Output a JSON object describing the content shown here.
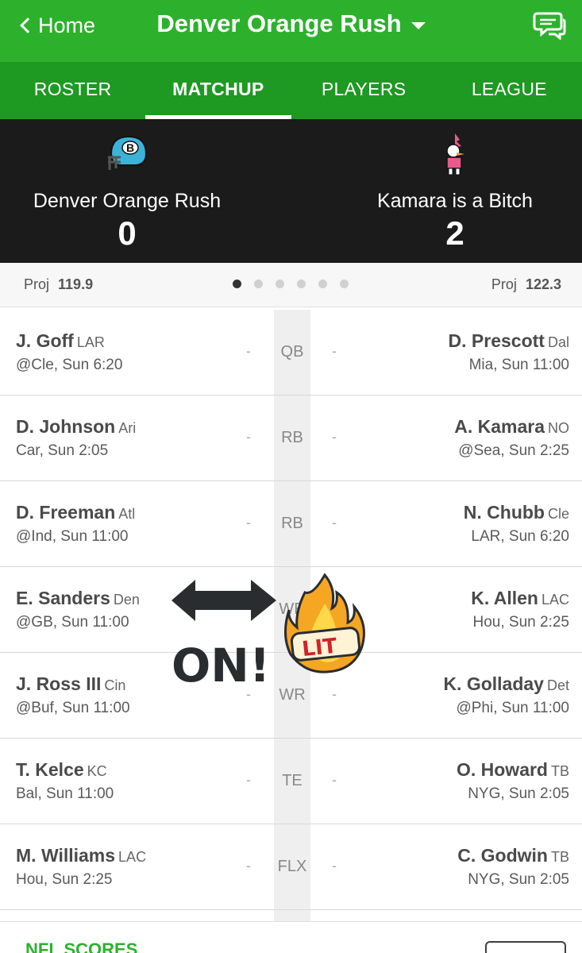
{
  "topbar": {
    "back_label": "Home",
    "team_name": "Denver Orange Rush"
  },
  "tabs": [
    {
      "label": "ROSTER"
    },
    {
      "label": "MATCHUP",
      "active": true
    },
    {
      "label": "PLAYERS"
    },
    {
      "label": "LEAGUE"
    }
  ],
  "matchup": {
    "left": {
      "name": "Denver Orange Rush",
      "score": "0",
      "proj_label": "Proj",
      "proj_value": "119.9"
    },
    "right": {
      "name": "Kamara is a Bitch",
      "score": "2",
      "proj_label": "Proj",
      "proj_value": "122.3"
    },
    "page_dots": 6,
    "active_dot": 0
  },
  "rows": [
    {
      "slot": "QB",
      "left": {
        "name": "J. Goff",
        "team": "LAR",
        "game": "@Cle, Sun 6:20",
        "pts": "-"
      },
      "right": {
        "name": "D. Prescott",
        "team": "Dal",
        "game": "Mia, Sun 11:00",
        "pts": "-"
      }
    },
    {
      "slot": "RB",
      "left": {
        "name": "D. Johnson",
        "team": "Ari",
        "game": "Car, Sun 2:05",
        "pts": "-"
      },
      "right": {
        "name": "A. Kamara",
        "team": "NO",
        "game": "@Sea, Sun 2:25",
        "pts": "-"
      }
    },
    {
      "slot": "RB",
      "left": {
        "name": "D. Freeman",
        "team": "Atl",
        "game": "@Ind, Sun 11:00",
        "pts": "-"
      },
      "right": {
        "name": "N. Chubb",
        "team": "Cle",
        "game": "LAR, Sun 6:20",
        "pts": "-"
      }
    },
    {
      "slot": "WR",
      "left": {
        "name": "E. Sanders",
        "team": "Den",
        "game": "@GB, Sun 11:00",
        "pts": "-"
      },
      "right": {
        "name": "K. Allen",
        "team": "LAC",
        "game": "Hou, Sun 2:25",
        "pts": "-"
      }
    },
    {
      "slot": "WR",
      "left": {
        "name": "J. Ross III",
        "team": "Cin",
        "game": "@Buf, Sun 11:00",
        "pts": "-"
      },
      "right": {
        "name": "K. Golladay",
        "team": "Det",
        "game": "@Phi, Sun 11:00",
        "pts": "-"
      }
    },
    {
      "slot": "TE",
      "left": {
        "name": "T. Kelce",
        "team": "KC",
        "game": "Bal, Sun 11:00",
        "pts": "-"
      },
      "right": {
        "name": "O. Howard",
        "team": "TB",
        "game": "NYG, Sun 2:05",
        "pts": "-"
      }
    },
    {
      "slot": "FLX",
      "left": {
        "name": "M. Williams",
        "team": "LAC",
        "game": "Hou, Sun 2:25",
        "pts": "-"
      },
      "right": {
        "name": "C. Godwin",
        "team": "TB",
        "game": "NYG, Sun 2:05",
        "pts": "-"
      }
    }
  ],
  "bottom": {
    "section_label": "NFL SCORES"
  },
  "stickers": {
    "on_text": "ON!",
    "lit_text": "LIT"
  },
  "colors": {
    "header_green": "#2db12d",
    "tab_green": "#1e9922",
    "scoreboard": "#1b1b1b"
  }
}
